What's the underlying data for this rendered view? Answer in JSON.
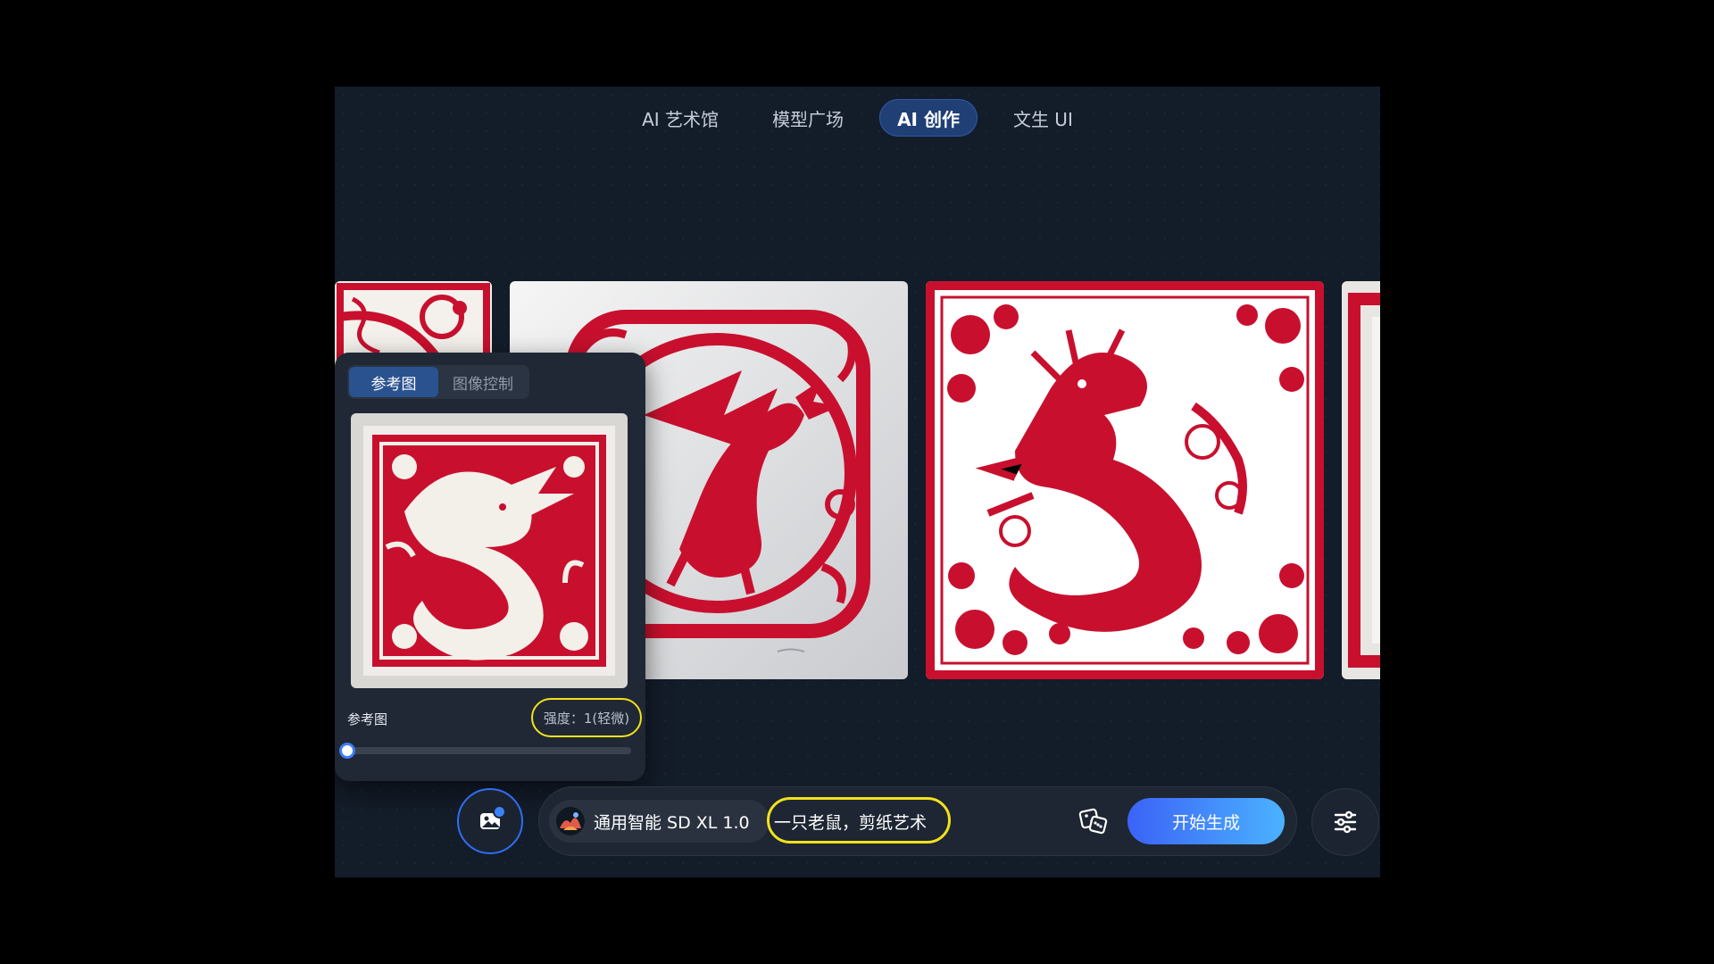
{
  "nav": {
    "items": [
      {
        "label": "AI 艺术馆",
        "active": false
      },
      {
        "label": "模型广场",
        "active": false
      },
      {
        "label": "AI 创作",
        "active": true
      },
      {
        "label": "文生 UI",
        "active": false
      }
    ]
  },
  "gallery": {
    "images": [
      {
        "subject": "red papercut pattern (partial)"
      },
      {
        "subject": "red papercut dragon in ornate circle"
      },
      {
        "subject": "red papercut dragon with floral border"
      },
      {
        "subject": "red papercut frame (partial)"
      }
    ]
  },
  "reference_panel": {
    "tabs": [
      {
        "label": "参考图",
        "active": true
      },
      {
        "label": "图像控制",
        "active": false
      }
    ],
    "image_subject": "white papercut dragon on red background",
    "label": "参考图",
    "strength_text": "强度：1(轻微)",
    "strength_fraction": 0.0
  },
  "toolbar": {
    "upload_icon": "image-upload-icon",
    "model_name": "通用智能 SD XL 1.0",
    "prompt": "一只老鼠，剪纸艺术",
    "dice_icon": "dice-icon",
    "generate_label": "开始生成",
    "settings_icon": "sliders-icon"
  },
  "colors": {
    "accent": "#2e6ff0",
    "highlight": "#f2e21c",
    "papercut_red": "#c8102e"
  }
}
